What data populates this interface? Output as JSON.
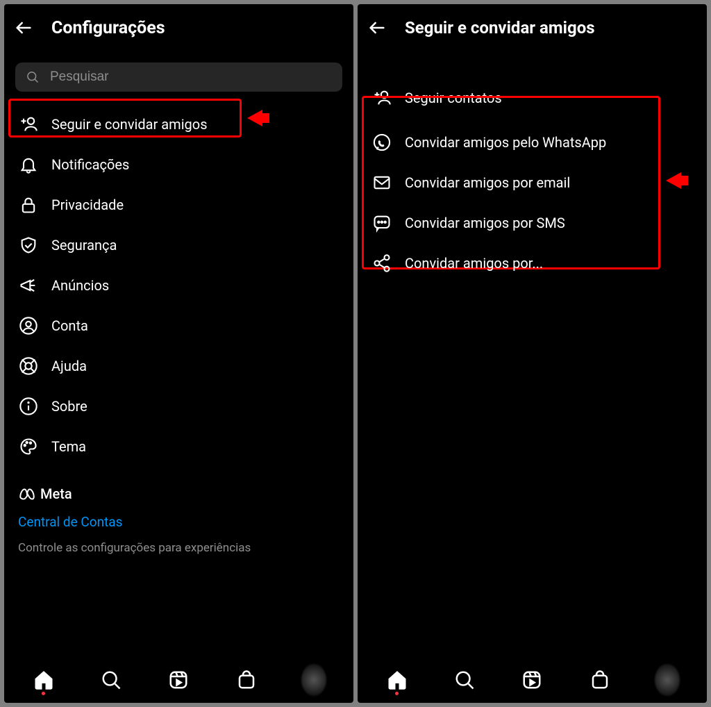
{
  "left": {
    "title": "Configurações",
    "search_placeholder": "Pesquisar",
    "items": [
      {
        "label": "Seguir e convidar amigos"
      },
      {
        "label": "Notificações"
      },
      {
        "label": "Privacidade"
      },
      {
        "label": "Segurança"
      },
      {
        "label": "Anúncios"
      },
      {
        "label": "Conta"
      },
      {
        "label": "Ajuda"
      },
      {
        "label": "Sobre"
      },
      {
        "label": "Tema"
      }
    ],
    "meta_brand": "Meta",
    "accounts_link": "Central de Contas",
    "caption": "Controle as configurações para experiências"
  },
  "right": {
    "title": "Seguir e convidar amigos",
    "items": [
      {
        "label": "Seguir contatos"
      },
      {
        "label": "Convidar amigos pelo WhatsApp"
      },
      {
        "label": "Convidar amigos por email"
      },
      {
        "label": "Convidar amigos por SMS"
      },
      {
        "label": "Convidar amigos por..."
      }
    ]
  }
}
